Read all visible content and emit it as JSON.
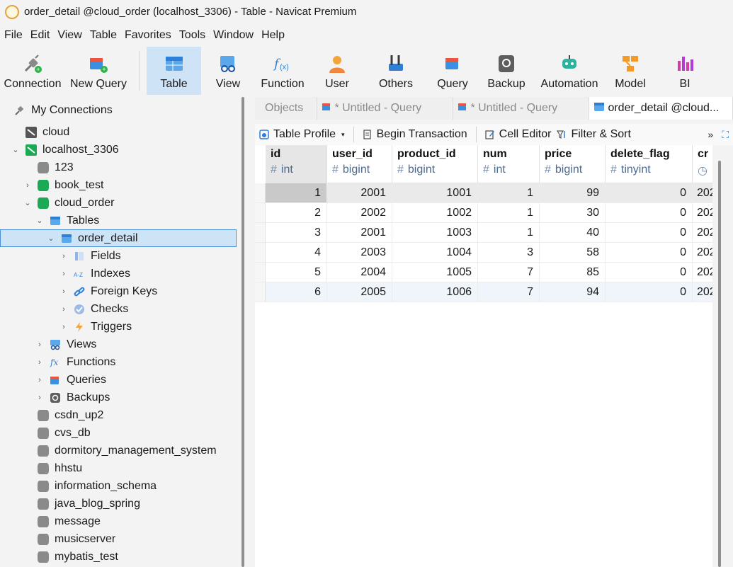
{
  "window": {
    "title": "order_detail @cloud_order (localhost_3306) - Table - Navicat Premium"
  },
  "menu": [
    "File",
    "Edit",
    "View",
    "Table",
    "Favorites",
    "Tools",
    "Window",
    "Help"
  ],
  "toolbar": {
    "connection": "Connection",
    "new_query": "New Query",
    "table": "Table",
    "view": "View",
    "function": "Function",
    "user": "User",
    "others": "Others",
    "query": "Query",
    "backup": "Backup",
    "automation": "Automation",
    "model": "Model",
    "bi": "BI"
  },
  "tree": {
    "header": "My Connections",
    "items": [
      {
        "label": "cloud"
      },
      {
        "label": "localhost_3306"
      },
      {
        "label": "123"
      },
      {
        "label": "book_test"
      },
      {
        "label": "cloud_order"
      },
      {
        "label": "Tables"
      },
      {
        "label": "order_detail"
      },
      {
        "label": "Fields"
      },
      {
        "label": "Indexes"
      },
      {
        "label": "Foreign Keys"
      },
      {
        "label": "Checks"
      },
      {
        "label": "Triggers"
      },
      {
        "label": "Views"
      },
      {
        "label": "Functions"
      },
      {
        "label": "Queries"
      },
      {
        "label": "Backups"
      },
      {
        "label": "csdn_up2"
      },
      {
        "label": "cvs_db"
      },
      {
        "label": "dormitory_management_system"
      },
      {
        "label": "hhstu"
      },
      {
        "label": "information_schema"
      },
      {
        "label": "java_blog_spring"
      },
      {
        "label": "message"
      },
      {
        "label": "musicserver"
      },
      {
        "label": "mybatis_test"
      }
    ]
  },
  "tabs": [
    "Objects",
    "* Untitled - Query",
    "* Untitled - Query",
    "order_detail @cloud..."
  ],
  "subtoolbar": {
    "table_profile": "Table Profile",
    "begin_transaction": "Begin Transaction",
    "cell_editor": "Cell Editor",
    "filter_sort": "Filter & Sort",
    "more": "»"
  },
  "grid": {
    "columns": [
      {
        "name": "id",
        "type": "int"
      },
      {
        "name": "user_id",
        "type": "bigint"
      },
      {
        "name": "product_id",
        "type": "bigint"
      },
      {
        "name": "num",
        "type": "int"
      },
      {
        "name": "price",
        "type": "bigint"
      },
      {
        "name": "delete_flag",
        "type": "tinyint"
      },
      {
        "name": "cr",
        "type": ""
      }
    ],
    "rows": [
      [
        "1",
        "2001",
        "1001",
        "1",
        "99",
        "0",
        "202"
      ],
      [
        "2",
        "2002",
        "1002",
        "1",
        "30",
        "0",
        "202"
      ],
      [
        "3",
        "2001",
        "1003",
        "1",
        "40",
        "0",
        "202"
      ],
      [
        "4",
        "2003",
        "1004",
        "3",
        "58",
        "0",
        "202"
      ],
      [
        "5",
        "2004",
        "1005",
        "7",
        "85",
        "0",
        "202"
      ],
      [
        "6",
        "2005",
        "1006",
        "7",
        "94",
        "0",
        "202"
      ]
    ]
  },
  "colors": {
    "accent": "#4a90d9",
    "selection": "#cde4f7",
    "active_tab": "#ffffff"
  }
}
